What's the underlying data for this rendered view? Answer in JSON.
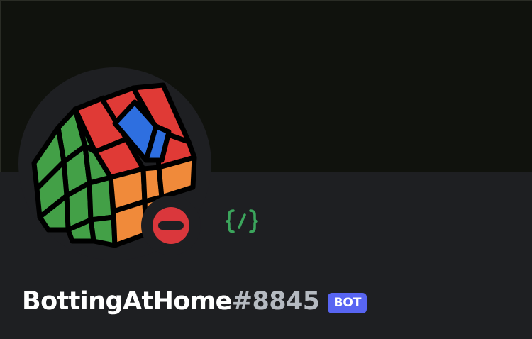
{
  "profile": {
    "username": "BottingAtHome",
    "discriminator": "#8845",
    "bot_tag": "BOT",
    "status": "do-not-disturb",
    "avatar_icon": "rubiks-house-icon",
    "badges": [
      {
        "icon": "slash-commands-icon",
        "color": "#3ba55c"
      }
    ]
  },
  "colors": {
    "banner": "#10120d",
    "background": "#1e1f22",
    "bot_tag": "#5865f2",
    "dnd_status": "#da373c",
    "discriminator": "#b5bac1"
  }
}
